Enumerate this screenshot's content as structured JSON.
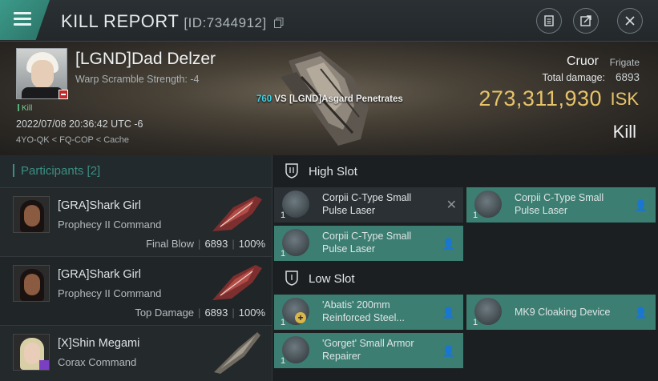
{
  "header": {
    "title": "KILL REPORT",
    "report_id": "[ID:7344912]",
    "icons": [
      "menu-icon",
      "copy-icon",
      "document-icon",
      "export-icon",
      "close-icon"
    ]
  },
  "victim": {
    "name": "[LGND]Dad Delzer",
    "subtitle": "Warp Scramble Strength: -4",
    "kill_tag": "Kill",
    "datetime": "2022/07/08 20:36:42 UTC -6",
    "location": "4YO-QK < FQ-COP < Cache",
    "ship_name": "Cruor",
    "ship_class": "Frigate",
    "total_damage_label": "Total damage:",
    "total_damage": "6893",
    "isk_value": "273,311,930",
    "isk_unit": "ISK",
    "result": "Kill"
  },
  "versus": {
    "count": "760",
    "vs": "VS",
    "name": "[LGND]Asgard Penetrates"
  },
  "participants": {
    "label": "Participants",
    "count": "[2]",
    "rows": [
      {
        "name": "[GRA]Shark Girl",
        "ship": "Prophecy II Command",
        "role": "Final Blow",
        "damage": "6893",
        "percent": "100%"
      },
      {
        "name": "[GRA]Shark Girl",
        "ship": "Prophecy II Command",
        "role": "Top Damage",
        "damage": "6893",
        "percent": "100%"
      },
      {
        "name": "[X]Shin Megami",
        "ship": "Corax Command",
        "role": "",
        "damage": "",
        "percent": ""
      }
    ]
  },
  "fitting": {
    "high_slot_label": "High Slot",
    "low_slot_label": "Low Slot",
    "high": [
      {
        "name": "Corpii C-Type Small Pulse Laser",
        "qty": "1",
        "state": "destroyed"
      },
      {
        "name": "Corpii C-Type Small Pulse Laser",
        "qty": "1",
        "state": "dropped"
      },
      {
        "name": "Corpii C-Type Small Pulse Laser",
        "qty": "1",
        "state": "dropped"
      }
    ],
    "low": [
      {
        "name": "'Abatis' 200mm Reinforced Steel...",
        "qty": "1",
        "state": "dropped"
      },
      {
        "name": "MK9 Cloaking Device",
        "qty": "1",
        "state": "dropped"
      },
      {
        "name": "'Gorget' Small Armor Repairer",
        "qty": "1",
        "state": "dropped"
      }
    ]
  },
  "colors": {
    "accent": "#3c9a8a",
    "isk": "#e7c36a",
    "fitted_module": "#3c7e72",
    "vs_count": "#3fd1e6"
  }
}
